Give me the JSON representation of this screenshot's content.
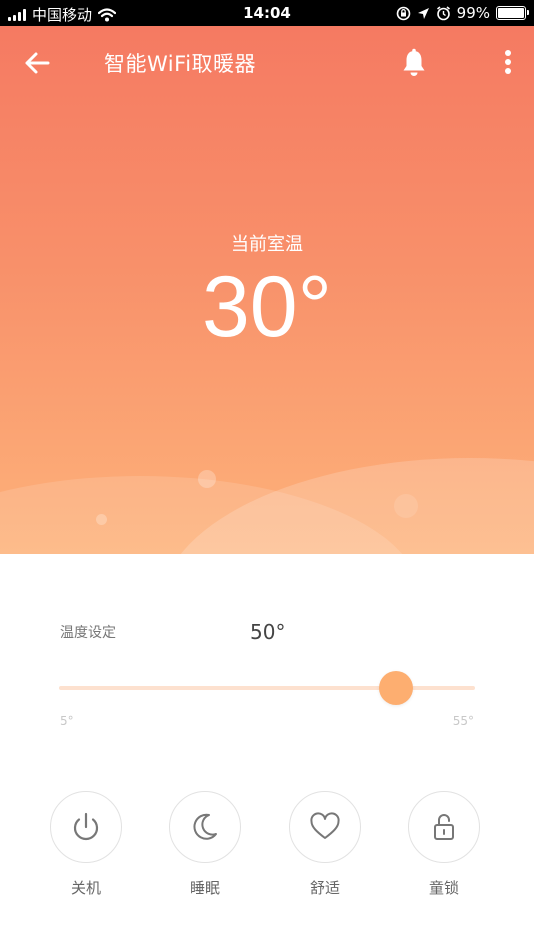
{
  "status_bar": {
    "carrier": "中国移动",
    "time": "14:04",
    "battery_percent": "99%",
    "battery_level": 0.99,
    "icons": [
      "signal-icon",
      "wifi-icon",
      "orientation-lock-icon",
      "location-icon",
      "alarm-icon",
      "battery-icon"
    ]
  },
  "header": {
    "title": "智能WiFi取暖器",
    "icons": [
      "back-arrow-icon",
      "bell-icon",
      "more-vertical-icon"
    ]
  },
  "current": {
    "label": "当前室温",
    "value": "30°"
  },
  "setting": {
    "label": "温度设定",
    "value": "50°",
    "slider": {
      "min": 5,
      "max": 55,
      "value": 50
    },
    "min_label": "5°",
    "max_label": "55°"
  },
  "controls": [
    {
      "label": "关机",
      "icon": "power-icon"
    },
    {
      "label": "睡眠",
      "icon": "moon-icon"
    },
    {
      "label": "舒适",
      "icon": "heart-icon"
    },
    {
      "label": "童锁",
      "icon": "lock-icon"
    }
  ],
  "colors": {
    "hero_top": "#f57a62",
    "hero_bottom": "#fdb27a",
    "accent": "#fdae70",
    "track": "#fde1cf"
  }
}
